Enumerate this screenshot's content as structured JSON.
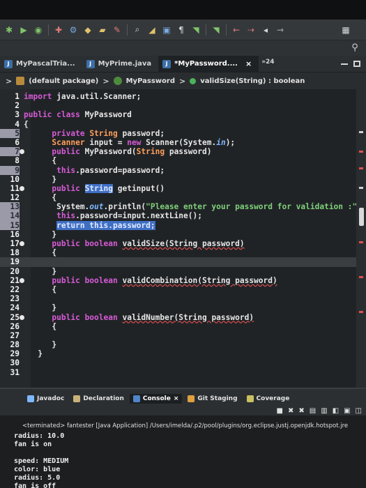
{
  "toolbar": {
    "icons": [
      "debug-icon",
      "run-icon",
      "coverage-icon",
      "external-tools-icon",
      "build-icon",
      "new-class-icon",
      "new-package-icon",
      "open-type-icon",
      "search-tool-icon",
      "pilcrow-icon",
      "annotation-next-icon",
      "back-icon",
      "forward-icon",
      "perspective-icon"
    ],
    "pilcrow": "¶"
  },
  "tabs": [
    {
      "label": "MyPascalTria...",
      "active": false
    },
    {
      "label": "MyPrime.java",
      "active": false
    },
    {
      "label": "*MyPassword....",
      "active": true,
      "close": "×"
    }
  ],
  "tab_overflow": "»24",
  "breadcrumb": {
    "package": "(default package)",
    "class": "MyPassword",
    "method": "validSize(String) : boolean",
    "separator": ">"
  },
  "code_lines": [
    {
      "n": "1",
      "parts": [
        [
          "kw",
          "import "
        ],
        [
          "",
          "java.util.Scanner;"
        ]
      ]
    },
    {
      "n": "2",
      "parts": []
    },
    {
      "n": "3",
      "parts": [
        [
          "kw",
          "public class "
        ],
        [
          "",
          "MyPassword"
        ]
      ]
    },
    {
      "n": "4",
      "parts": [
        [
          "",
          "{"
        ]
      ]
    },
    {
      "n": "5",
      "hl": true,
      "parts": [
        [
          "",
          "      "
        ],
        [
          "kw",
          "private "
        ],
        [
          "ty",
          "String "
        ],
        [
          "",
          "password;"
        ]
      ]
    },
    {
      "n": "6",
      "parts": [
        [
          "",
          "      "
        ],
        [
          "ty",
          "Scanner "
        ],
        [
          "",
          "input = "
        ],
        [
          "kw",
          "new "
        ],
        [
          "",
          "Scanner(System."
        ],
        [
          "static",
          "in"
        ],
        [
          "",
          ");"
        ]
      ]
    },
    {
      "n": "7",
      "hl": true,
      "marker": true,
      "parts": [
        [
          "",
          "      "
        ],
        [
          "kw",
          "public "
        ],
        [
          "",
          "MyPassword("
        ],
        [
          "ty",
          "String "
        ],
        [
          "",
          "password)"
        ]
      ]
    },
    {
      "n": "8",
      "parts": [
        [
          "",
          "      {"
        ]
      ]
    },
    {
      "n": "9",
      "hl": true,
      "parts": [
        [
          "",
          "       "
        ],
        [
          "kw",
          "this"
        ],
        [
          "",
          ".password=password;"
        ]
      ]
    },
    {
      "n": "10",
      "parts": [
        [
          "",
          "      }"
        ]
      ]
    },
    {
      "n": "11",
      "marker": true,
      "parts": [
        [
          "",
          "      "
        ],
        [
          "kw",
          "public "
        ],
        [
          "sel",
          "String"
        ],
        [
          "",
          " getinput()"
        ]
      ]
    },
    {
      "n": "12",
      "parts": [
        [
          "",
          "      {"
        ]
      ]
    },
    {
      "n": "13",
      "hl": true,
      "parts": [
        [
          "",
          "       System."
        ],
        [
          "static",
          "out"
        ],
        [
          "",
          ".println("
        ],
        [
          "str",
          "\"Please enter your password for validation :\""
        ]
      ]
    },
    {
      "n": "14",
      "hl": true,
      "parts": [
        [
          "",
          "       "
        ],
        [
          "kw",
          "this"
        ],
        [
          "",
          ".password=input.nextLine();"
        ]
      ]
    },
    {
      "n": "15",
      "hl": true,
      "parts": [
        [
          "",
          "       "
        ],
        [
          "sel",
          "return this.password;"
        ]
      ]
    },
    {
      "n": "16",
      "parts": [
        [
          "",
          "      }"
        ]
      ]
    },
    {
      "n": "17",
      "marker": true,
      "parts": [
        [
          "",
          "      "
        ],
        [
          "kw",
          "public boolean "
        ],
        [
          "err",
          "validSize(String password)"
        ]
      ]
    },
    {
      "n": "18",
      "parts": [
        [
          "",
          "      {"
        ]
      ]
    },
    {
      "n": "19",
      "current": true,
      "parts": []
    },
    {
      "n": "20",
      "parts": [
        [
          "",
          "      }"
        ]
      ]
    },
    {
      "n": "21",
      "marker": true,
      "parts": [
        [
          "",
          "      "
        ],
        [
          "kw",
          "public boolean "
        ],
        [
          "err",
          "validCombination(String password)"
        ]
      ]
    },
    {
      "n": "22",
      "parts": [
        [
          "",
          "      {"
        ]
      ]
    },
    {
      "n": "23",
      "parts": []
    },
    {
      "n": "24",
      "parts": [
        [
          "",
          "      }"
        ]
      ]
    },
    {
      "n": "25",
      "marker": true,
      "parts": [
        [
          "",
          "      "
        ],
        [
          "kw",
          "public boolean "
        ],
        [
          "err",
          "validNumber(String password)"
        ]
      ]
    },
    {
      "n": "26",
      "parts": [
        [
          "",
          "      {"
        ]
      ]
    },
    {
      "n": "27",
      "parts": []
    },
    {
      "n": "28",
      "parts": [
        [
          "",
          "      }"
        ]
      ]
    },
    {
      "n": "29",
      "parts": [
        [
          "",
          "   }"
        ]
      ]
    },
    {
      "n": "30",
      "parts": []
    },
    {
      "n": "31",
      "parts": []
    }
  ],
  "bottom_tabs": [
    {
      "label": "Javadoc",
      "active": false,
      "icon": "javadoc-icon"
    },
    {
      "label": "Declaration",
      "active": false,
      "icon": "declaration-icon"
    },
    {
      "label": "Console",
      "active": true,
      "icon": "console-icon",
      "close": "×"
    },
    {
      "label": "Git Staging",
      "active": false,
      "icon": "git-staging-icon"
    },
    {
      "label": "Coverage",
      "active": false,
      "icon": "coverage-tab-icon"
    }
  ],
  "console": {
    "terminated": "<terminated> fantester [Java Application] /Users/imelda/.p2/pool/plugins/org.eclipse.justj.openjdk.hotspot.jre",
    "lines_block1": [
      "radius: 10.0",
      "fan is on"
    ],
    "lines_block2": [
      "speed: MEDIUM",
      "color: blue",
      "radius: 5.0",
      "fan is off"
    ]
  },
  "colors": {
    "keyword": "#d65bd6",
    "type": "#ff9f5a",
    "string": "#7fd07a",
    "static_field": "#7fb8ff",
    "selection": "#3f6fc4",
    "error": "#e05050"
  }
}
